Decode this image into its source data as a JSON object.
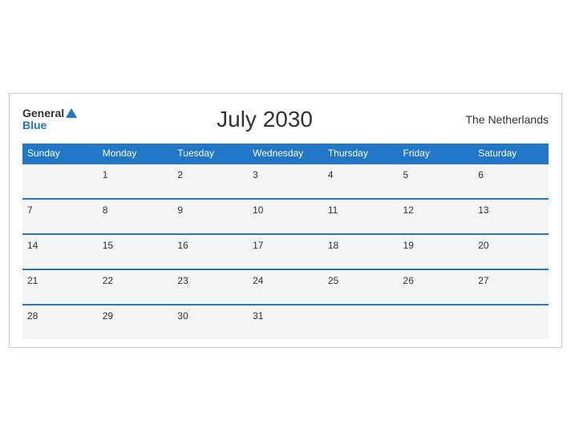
{
  "header": {
    "logo_general": "General",
    "logo_blue": "Blue",
    "title": "July 2030",
    "country": "The Netherlands"
  },
  "days_of_week": [
    "Sunday",
    "Monday",
    "Tuesday",
    "Wednesday",
    "Thursday",
    "Friday",
    "Saturday"
  ],
  "weeks": [
    [
      "",
      "1",
      "2",
      "3",
      "4",
      "5",
      "6"
    ],
    [
      "7",
      "8",
      "9",
      "10",
      "11",
      "12",
      "13"
    ],
    [
      "14",
      "15",
      "16",
      "17",
      "18",
      "19",
      "20"
    ],
    [
      "21",
      "22",
      "23",
      "24",
      "25",
      "26",
      "27"
    ],
    [
      "28",
      "29",
      "30",
      "31",
      "",
      "",
      ""
    ]
  ]
}
